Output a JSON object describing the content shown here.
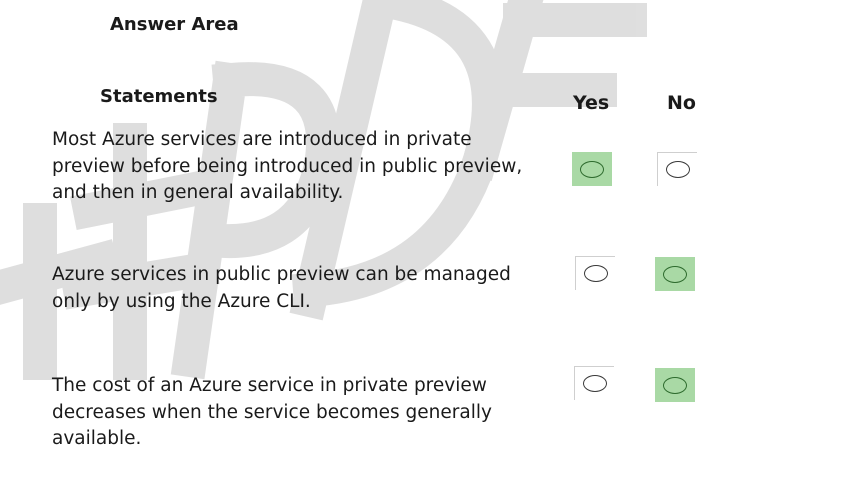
{
  "answer_area": {
    "title": "Answer Area"
  },
  "columns": {
    "statements": "Statements",
    "yes": "Yes",
    "no": "No"
  },
  "statements": [
    {
      "lines": [
        "Most Azure services are introduced in private",
        "preview before being introduced in public preview,",
        "and then in general availability."
      ],
      "selected": "yes"
    },
    {
      "lines": [
        "Azure services in public preview can be managed",
        "only by using the Azure CLI."
      ],
      "selected": "no"
    },
    {
      "lines": [
        "The cost of an Azure service in private preview",
        "decreases when the service becomes generally",
        "available."
      ],
      "selected": "no"
    }
  ],
  "colors": {
    "selected_highlight": "#a9d9a5",
    "watermark": "#d9d9d9"
  }
}
